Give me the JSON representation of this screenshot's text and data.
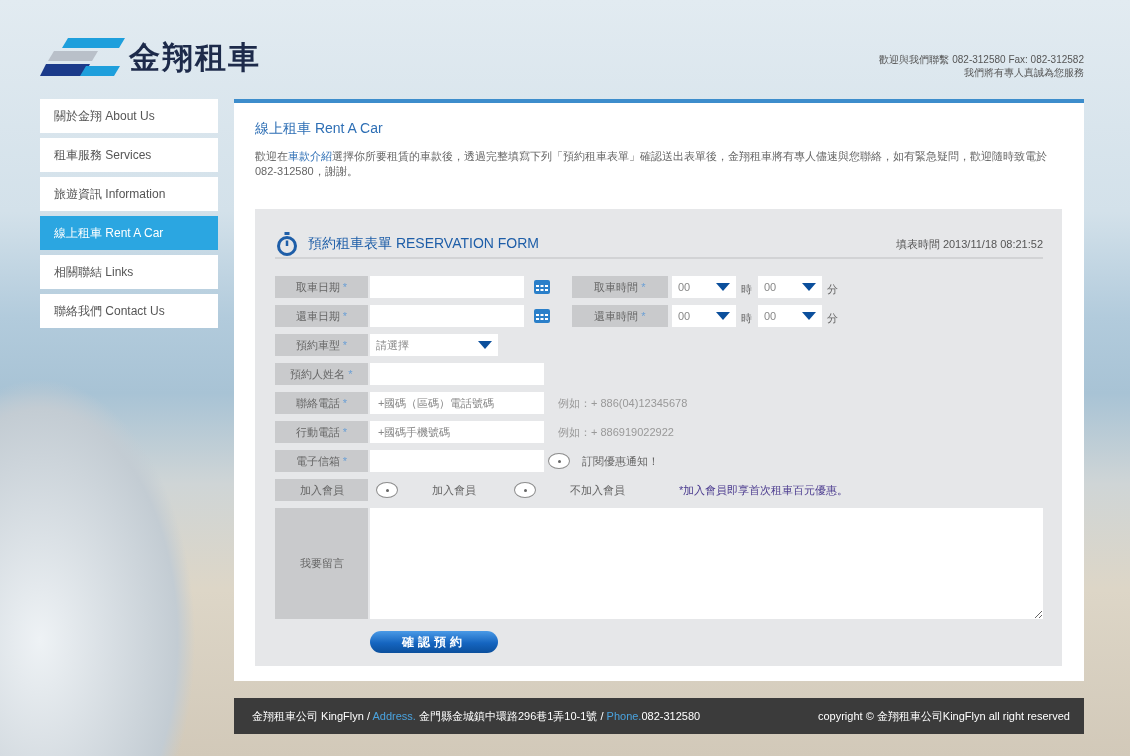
{
  "header": {
    "logo_text": "金翔租車",
    "contact_lines": [
      "歡迎與我們聯繫 082-312580 Fax: 082-312582",
      "我們將有專人真誠為您服務"
    ]
  },
  "sidebar": {
    "items": [
      {
        "label": "關於金翔 About Us",
        "selected": false
      },
      {
        "label": "租車服務 Services",
        "selected": false
      },
      {
        "label": "旅遊資訊 Information",
        "selected": false
      },
      {
        "label": "線上租車 Rent A Car",
        "selected": true
      },
      {
        "label": "相關聯結 Links",
        "selected": false
      },
      {
        "label": "聯絡我們 Contact Us",
        "selected": false
      }
    ]
  },
  "content": {
    "title": "線上租車 Rent A Car",
    "intro": {
      "before": "歡迎在",
      "link": "車款介紹",
      "after": "選擇你所要租賃的車款後，透過完整填寫下列「預約租車表單」確認送出表單後，金翔租車將有專人儘速與您聯絡，如有緊急疑問，歡迎隨時致電於082-312580，謝謝。"
    }
  },
  "form": {
    "title": "預約租車表單 RESERVATION FORM",
    "timestamp": "填表時間 2013/11/18 08:21:52",
    "rows": [
      {
        "kind": "datetime",
        "label": "取車日期",
        "mark": "*",
        "time_label": "取車時間",
        "time_mark": "*",
        "hour": "00",
        "hour_unit": "時",
        "minute": "00",
        "minute_unit": "分"
      },
      {
        "kind": "datetime",
        "label": "還車日期",
        "mark": "*",
        "time_label": "還車時間",
        "time_mark": "*",
        "hour": "00",
        "hour_unit": "時",
        "minute": "00",
        "minute_unit": "分"
      },
      {
        "kind": "select",
        "label": "預約車型",
        "mark": "*",
        "value": "請選擇"
      },
      {
        "kind": "text",
        "label": "預約人姓名",
        "mark": "*"
      },
      {
        "kind": "text",
        "label": "聯絡電話",
        "mark": "*",
        "placeholder": "+國碼（區碼）電話號碼",
        "hint": "例如：+ 886(04)12345678"
      },
      {
        "kind": "text",
        "label": "行動電話",
        "mark": "*",
        "placeholder": "+國碼手機號碼",
        "hint": "例如：+ 886919022922"
      },
      {
        "kind": "email",
        "label": "電子信箱",
        "mark": "*",
        "option": {
          "label": "訂閱優惠通知！",
          "checked": false
        }
      },
      {
        "kind": "radio",
        "label": "加入會員",
        "options": [
          {
            "label": "加入會員",
            "selected": false
          },
          {
            "label": "不加入會員",
            "selected": false
          }
        ],
        "note": "*加入會員即享首次租車百元優惠。"
      },
      {
        "kind": "message",
        "label": "我要留言"
      }
    ],
    "submit": "確認預約"
  },
  "footer": {
    "company": "金翔租車公司 KingFlyn /",
    "address_label": "Address.",
    "address": "金門縣金城鎮中環路296巷1弄10-1號 /",
    "phone_label": "Phone.",
    "phone": "082-312580",
    "copyright": "copyright © 金翔租車公司KingFlyn all right reserved"
  }
}
